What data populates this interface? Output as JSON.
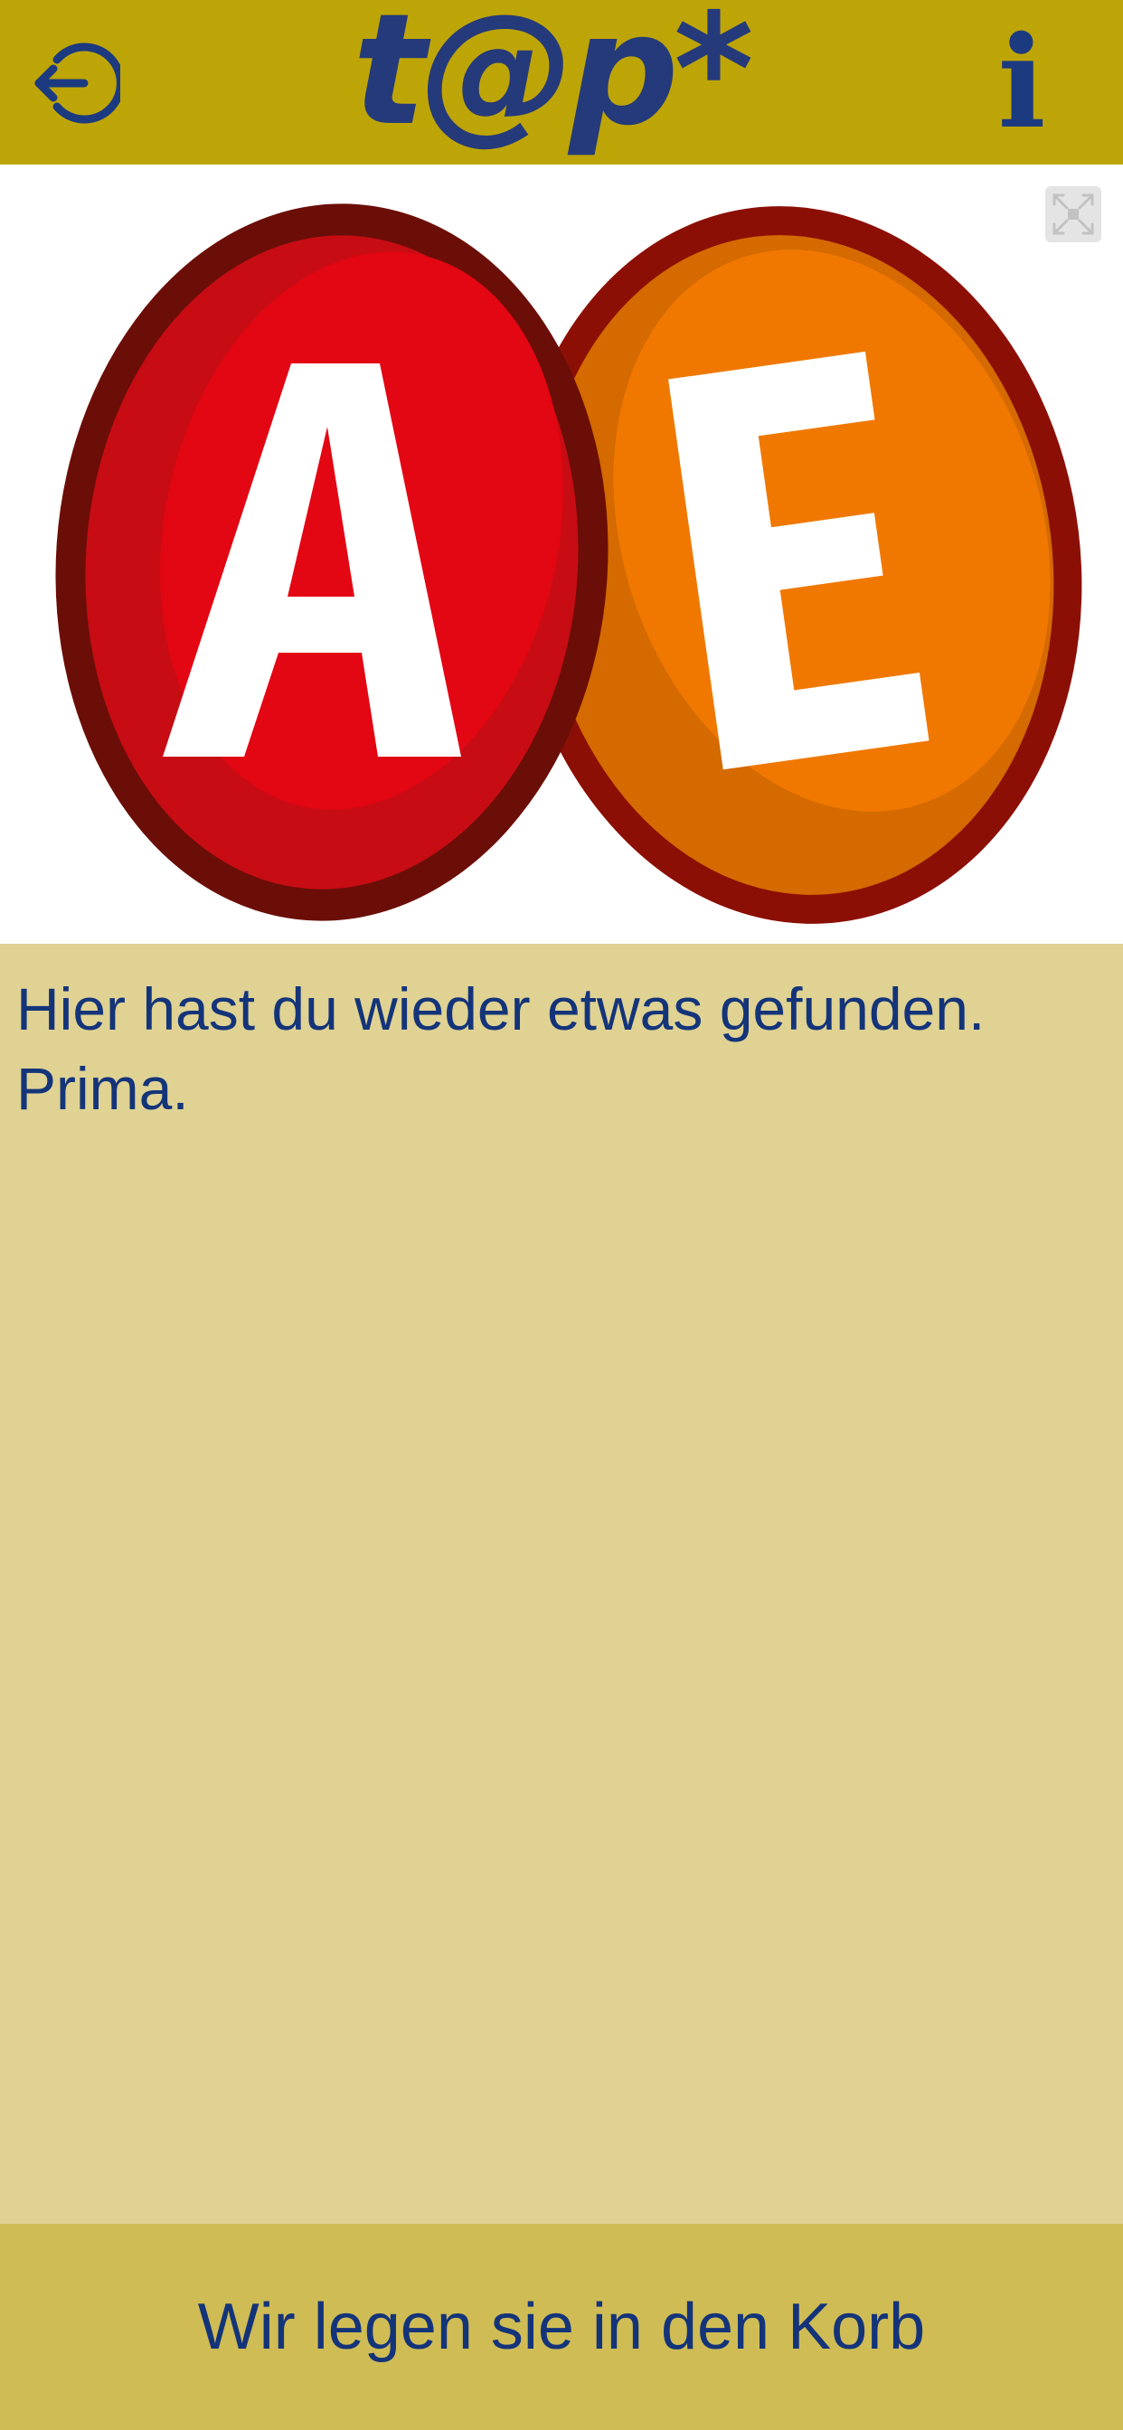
{
  "header": {
    "back_icon": "logout-arrow-icon",
    "logo_text": "t@p*",
    "info_label": "i",
    "background": "#BEA507",
    "accent": "#1C3A80"
  },
  "image": {
    "letters": [
      "A",
      "E"
    ],
    "egg_colors": [
      "#E30613",
      "#F07800"
    ],
    "expand_icon": "fullscreen-icon"
  },
  "content": {
    "message": "Hier hast du wieder etwas gefunden. Prima.",
    "background": "#DFD293"
  },
  "footer": {
    "button_label": "Wir legen sie in den Korb",
    "background": "#CFBC55"
  }
}
